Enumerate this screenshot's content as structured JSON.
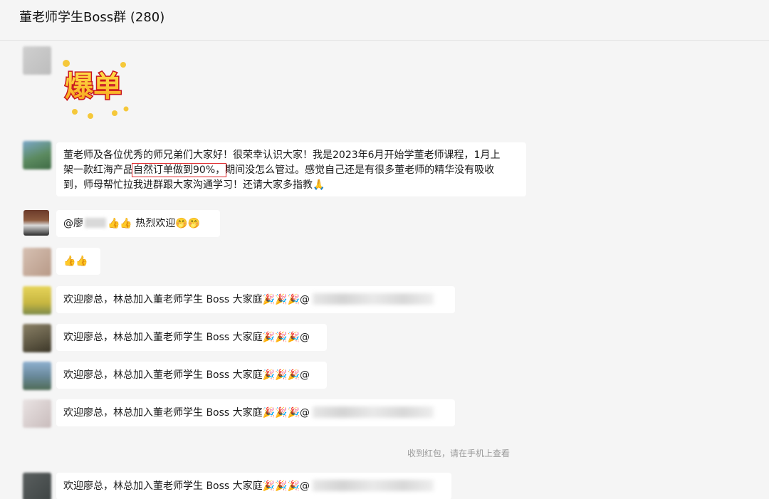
{
  "chat": {
    "title": "董老师学生Boss群 (280)"
  },
  "sticker": {
    "text": "爆单"
  },
  "messages": {
    "intro": {
      "line1": "董老师及各位优秀的师兄弟们大家好！很荣幸认识大家！我是2023年6月开始学董老师课程，1月上",
      "line2_a": "架一款红海产品",
      "line2_highlight": "自然订单做到90%，",
      "line2_b": "期间没怎么管过。感觉自己还是有很多董老师的精华没有吸收",
      "line3": "到，师母帮忙拉我进群跟大家沟通学习！还请大家多指教🙏"
    },
    "reply": {
      "prefix": "@廖",
      "suffix": "👍👍 热烈欢迎🤭🤭"
    },
    "thumbs": {
      "text": "👍👍"
    },
    "welcome": {
      "text": "欢迎廖总，林总加入董老师学生 Boss 大家庭🎉🎉🎉@"
    }
  },
  "system": {
    "red_packet_note": "收到红包，请在手机上查看"
  },
  "colors": {
    "highlight_box": "#e0262a",
    "bubble_bg": "#ffffff",
    "window_bg": "#f5f5f5"
  }
}
